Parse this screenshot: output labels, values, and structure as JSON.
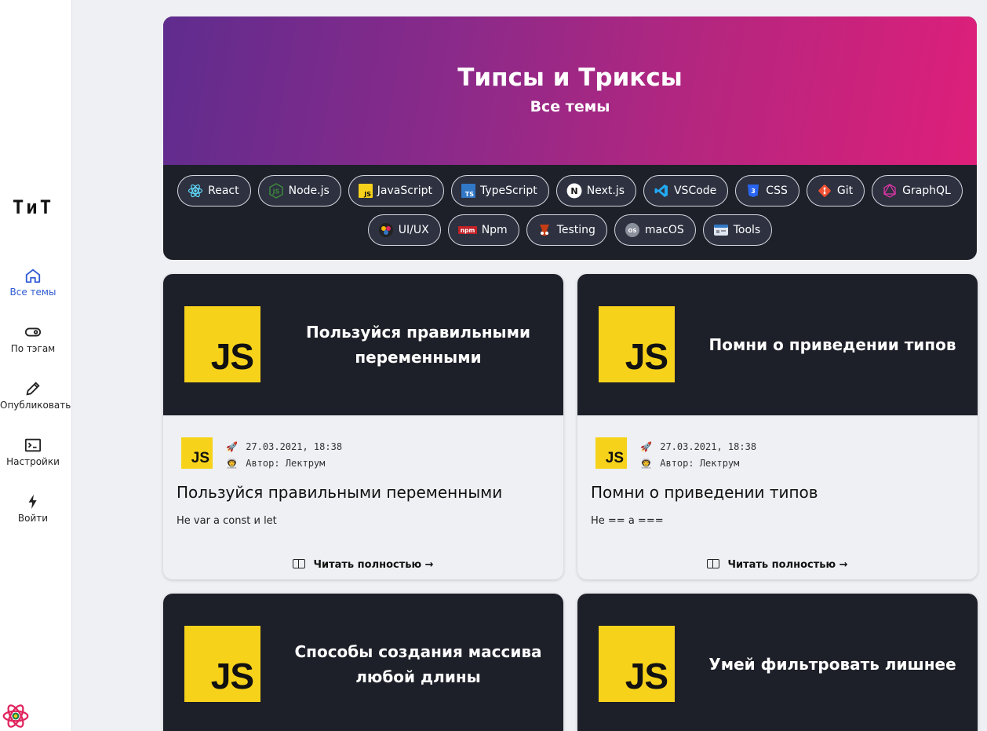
{
  "sidebar": {
    "logo": "ТиТ",
    "items": [
      {
        "label": "Все темы",
        "active": true
      },
      {
        "label": "По тэгам"
      },
      {
        "label": "Опубликовать"
      },
      {
        "label": "Настройки"
      },
      {
        "label": "Войти"
      }
    ]
  },
  "hero": {
    "title": "Типсы и Триксы",
    "subtitle": "Все темы"
  },
  "tags": {
    "row1": [
      {
        "label": "React",
        "icon": "react-icon"
      },
      {
        "label": "Node.js",
        "icon": "nodejs-icon"
      },
      {
        "label": "JavaScript",
        "icon": "javascript-icon"
      },
      {
        "label": "TypeScript",
        "icon": "typescript-icon"
      },
      {
        "label": "Next.js",
        "icon": "nextjs-icon"
      },
      {
        "label": "VSCode",
        "icon": "vscode-icon"
      },
      {
        "label": "CSS",
        "icon": "css-icon"
      },
      {
        "label": "Git",
        "icon": "git-icon"
      },
      {
        "label": "GraphQL",
        "icon": "graphql-icon"
      }
    ],
    "row2": [
      {
        "label": "UI/UX",
        "icon": "uiux-icon"
      },
      {
        "label": "Npm",
        "icon": "npm-icon"
      },
      {
        "label": "Testing",
        "icon": "testing-icon"
      },
      {
        "label": "macOS",
        "icon": "macos-icon"
      },
      {
        "label": "Tools",
        "icon": "tools-icon"
      }
    ]
  },
  "cards": [
    {
      "logo_text": "JS",
      "head_title": "Пользуйся правильными переменными",
      "date": "27.03.2021, 18:38",
      "author": "Автор: Лектрум",
      "title": "Пользуйся правильными переменными",
      "excerpt": "Не var а const и let",
      "read_more": "Читать полностью →"
    },
    {
      "logo_text": "JS",
      "head_title": "Помни о приведении типов",
      "date": "27.03.2021, 18:38",
      "author": "Автор: Лектрум",
      "title": "Помни о приведении типов",
      "excerpt": "Не == а ===",
      "read_more": "Читать полностью →"
    },
    {
      "logo_text": "JS",
      "head_title": "Способы создания массива любой длины"
    },
    {
      "logo_text": "JS",
      "head_title": "Умей фильтровать лишнее"
    }
  ],
  "colors": {
    "accent": "#2f5bd3",
    "hero_gradient_start": "#5f2c8e",
    "hero_gradient_end": "#de1f7a",
    "dark": "#1e2029",
    "js_yellow": "#f7d21b"
  }
}
